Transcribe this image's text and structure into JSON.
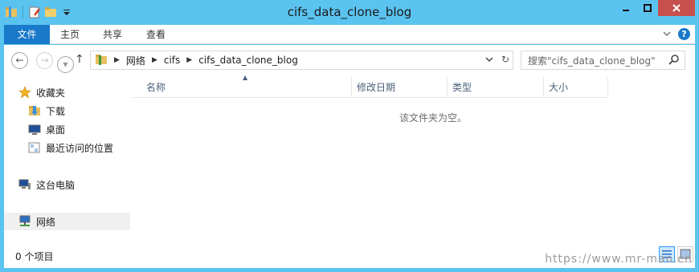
{
  "window": {
    "title": "cifs_data_clone_blog",
    "minimize": "▁",
    "maximize": "□",
    "close": "✕"
  },
  "ribbon": {
    "tabs": [
      {
        "label": "文件"
      },
      {
        "label": "主页"
      },
      {
        "label": "共享"
      },
      {
        "label": "查看"
      }
    ],
    "help": "?",
    "expand": "⌄"
  },
  "nav": {
    "back": "←",
    "forward": "→",
    "up": "↑",
    "breadcrumb": [
      "网络",
      "cifs",
      "cifs_data_clone_blog"
    ],
    "refresh": "↻",
    "dropdown": "⌄",
    "search_placeholder": "搜索\"cifs_data_clone_blog\""
  },
  "sidebar": {
    "items": [
      {
        "label": "收藏夹",
        "icon": "star-icon"
      },
      {
        "label": "下载",
        "icon": "download-folder-icon"
      },
      {
        "label": "桌面",
        "icon": "desktop-icon"
      },
      {
        "label": "最近访问的位置",
        "icon": "recent-places-icon"
      },
      {
        "label": "这台电脑",
        "icon": "computer-icon"
      },
      {
        "label": "网络",
        "icon": "network-icon"
      }
    ]
  },
  "content": {
    "columns": [
      "名称",
      "修改日期",
      "类型",
      "大小"
    ],
    "empty_message": "该文件夹为空。"
  },
  "status": {
    "item_count": "0 个项目"
  },
  "watermark": "https://www.mr-mao.cn",
  "colors": {
    "titlebar": "#5bc3f0",
    "file_tab": "#1979ca",
    "close_button": "#c7504d",
    "column_header_text": "#4c607a"
  }
}
